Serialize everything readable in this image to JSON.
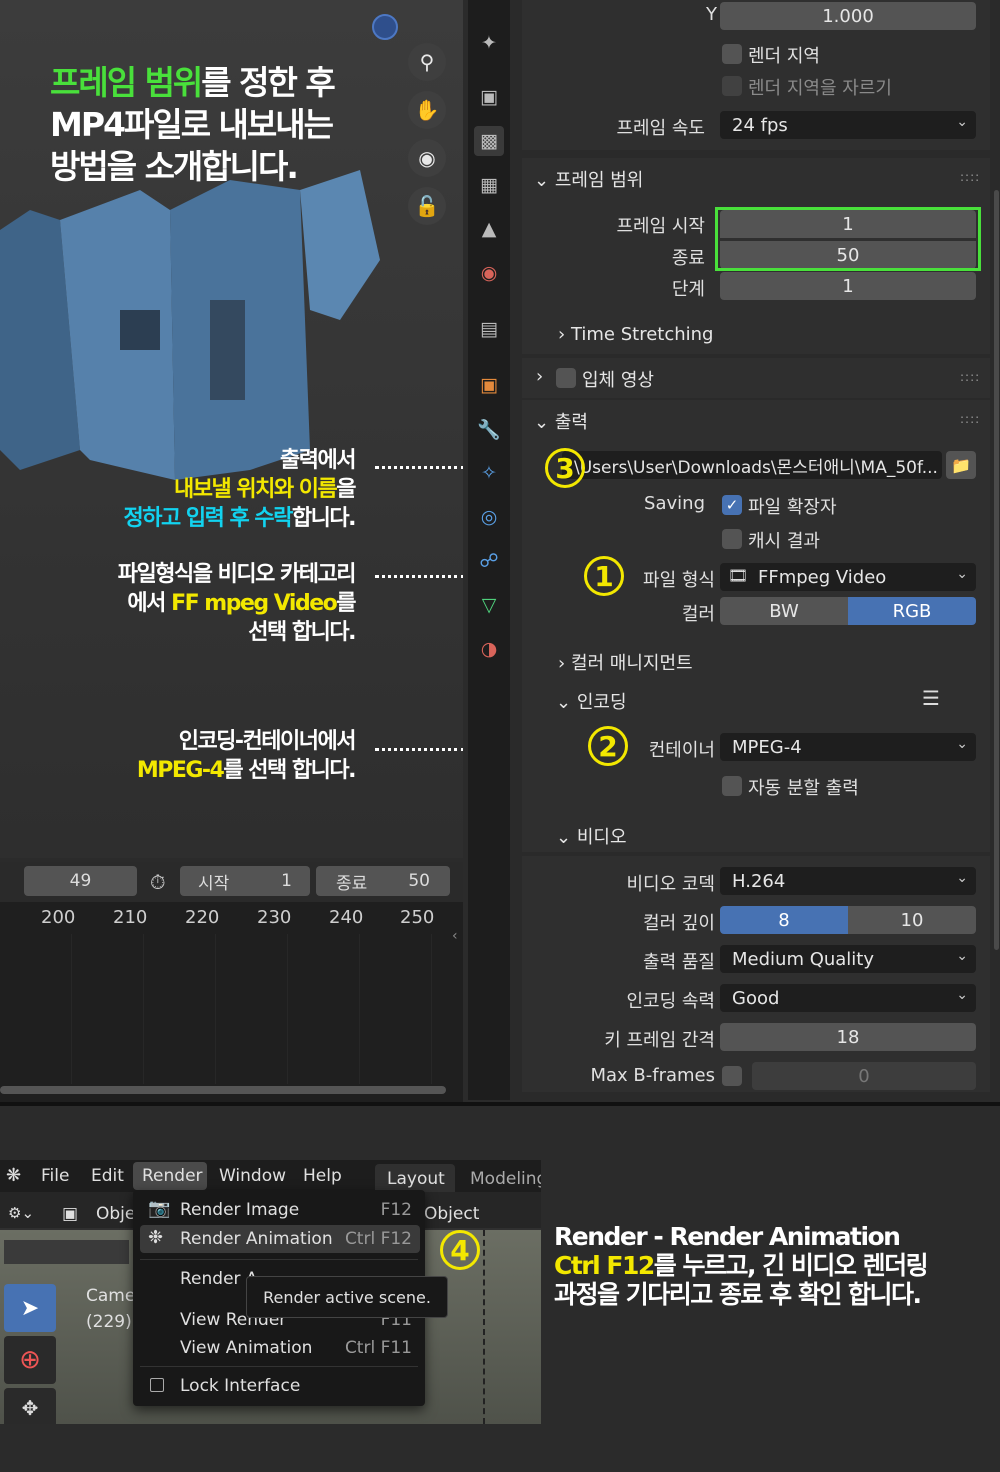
{
  "intro": {
    "line1_green": "프레임 범위",
    "line1_rest": "를 정한 후",
    "line2": "MP4파일로 내보내는",
    "line3": "방법을 소개합니다."
  },
  "viewport": {
    "tools": [
      "zoom-icon",
      "hand-icon",
      "camera-icon",
      "lock-icon"
    ]
  },
  "annotations": {
    "a3": {
      "line1": "출력에서",
      "line2_yellow": "내보낼 위치와 이름",
      "line2_rest": "을",
      "line3_cyan": "정하고 입력 후 수락",
      "line3_rest": "합니다.",
      "marker": "3"
    },
    "a1": {
      "line1": "파일형식을 비디오 카테고리",
      "line2_pre": "에서 ",
      "line2_yellow": "FF mpeg Video",
      "line2_rest": "를",
      "line3": "선택 합니다.",
      "marker": "1"
    },
    "a2": {
      "line1": "인코딩-컨테이너에서",
      "line2_yellow": "MPEG-4",
      "line2_rest": "를 선택 합니다.",
      "marker": "2"
    },
    "a4": {
      "line1": "Render - Render Animation",
      "line2_yellow": "Ctrl F12",
      "line2_rest": "를  누르고, 긴 비디오 렌더링",
      "line3": "과정을 기다리고 종료 후 확인 합니다.",
      "marker": "4"
    }
  },
  "timeline": {
    "current_frame": "49",
    "start_label": "시작",
    "start_value": "1",
    "end_label": "종료",
    "end_value": "50",
    "ticks": [
      "200",
      "210",
      "220",
      "230",
      "240",
      "250"
    ]
  },
  "props": {
    "y_label": "Y",
    "y_value": "1.000",
    "render_region": "렌더 지역",
    "crop_region": "렌더 지역을 자르기",
    "fps_label": "프레임 속도",
    "fps_value": "24 fps",
    "frame_range": {
      "title": "프레임 범위",
      "start_label": "프레임 시작",
      "start_value": "1",
      "end_label": "종료",
      "end_value": "50",
      "step_label": "단계",
      "step_value": "1",
      "time_stretching": "Time Stretching"
    },
    "stereoscopy": "입체 영상",
    "output": {
      "title": "출력",
      "path": "\\Users\\User\\Downloads\\몬스터애니\\MA_50f...",
      "saving_label": "Saving",
      "file_ext": "파일 확장자",
      "cache_result": "캐시 결과",
      "format_label": "파일 형식",
      "format_value": "FFmpeg Video",
      "color_label": "컬러",
      "color_bw": "BW",
      "color_rgb": "RGB",
      "color_management": "컬러 매니지먼트"
    },
    "encoding": {
      "title": "인코딩",
      "container_label": "컨테이너",
      "container_value": "MPEG-4",
      "autosplit": "자동 분할 출력"
    },
    "video": {
      "title": "비디오",
      "codec_label": "비디오 코덱",
      "codec_value": "H.264",
      "depth_label": "컬러 깊이",
      "depth_8": "8",
      "depth_10": "10",
      "quality_label": "출력 품질",
      "quality_value": "Medium Quality",
      "speed_label": "인코딩 속력",
      "speed_value": "Good",
      "keyframe_label": "키 프레임 간격",
      "keyframe_value": "18",
      "bframes_label": "Max B-frames",
      "bframes_value": "0"
    }
  },
  "menu": {
    "top": [
      "File",
      "Edit",
      "Render",
      "Window",
      "Help"
    ],
    "workspace_tabs": [
      "Layout",
      "Modeling"
    ],
    "obj_label": "Obje",
    "object_label": "Object",
    "camera_label": "Came",
    "camera_frame": "(229)",
    "items": [
      {
        "label": "Render Image",
        "shortcut": "F12"
      },
      {
        "label": "Render Animation",
        "shortcut": "Ctrl F12"
      },
      {
        "label": "Render A",
        "shortcut": ""
      },
      {
        "label": "View Render",
        "shortcut": "F11"
      },
      {
        "label": "View Animation",
        "shortcut": "Ctrl F11"
      },
      {
        "label": "Lock Interface",
        "shortcut": ""
      }
    ],
    "tooltip": "Render active scene."
  },
  "colors": {
    "accent_blue": "#4772b3",
    "highlight_green": "#49e03b",
    "annotation_yellow": "#f3e800",
    "annotation_cyan": "#12d3f0"
  }
}
